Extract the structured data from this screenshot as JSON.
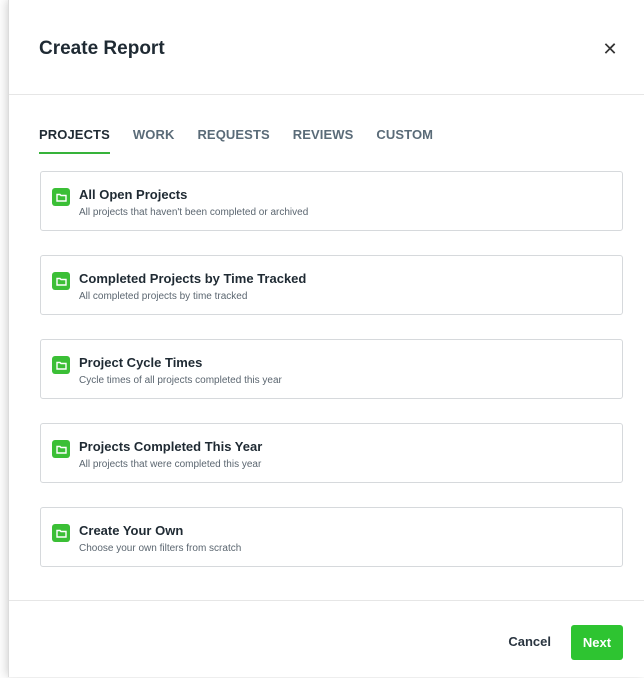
{
  "modal": {
    "title": "Create Report",
    "close_icon": "close-icon"
  },
  "tabs": [
    {
      "label": "PROJECTS",
      "active": true
    },
    {
      "label": "WORK",
      "active": false
    },
    {
      "label": "REQUESTS",
      "active": false
    },
    {
      "label": "REVIEWS",
      "active": false
    },
    {
      "label": "CUSTOM",
      "active": false
    }
  ],
  "reports": [
    {
      "icon": "folder-icon",
      "title": "All Open Projects",
      "description": "All projects that haven't been completed or archived"
    },
    {
      "icon": "folder-icon",
      "title": "Completed Projects by Time Tracked",
      "description": "All completed projects by time tracked"
    },
    {
      "icon": "folder-icon",
      "title": "Project Cycle Times",
      "description": "Cycle times of all projects completed this year"
    },
    {
      "icon": "folder-icon",
      "title": "Projects Completed This Year",
      "description": "All projects that were completed this year"
    },
    {
      "icon": "folder-icon",
      "title": "Create Your Own",
      "description": "Choose your own filters from scratch"
    }
  ],
  "footer": {
    "cancel_label": "Cancel",
    "next_label": "Next"
  },
  "colors": {
    "accent": "#2ec431",
    "icon_bg": "#3bbf36",
    "text_primary": "#1f2a33",
    "text_secondary": "#5b6670",
    "border": "#d6d9dc"
  }
}
